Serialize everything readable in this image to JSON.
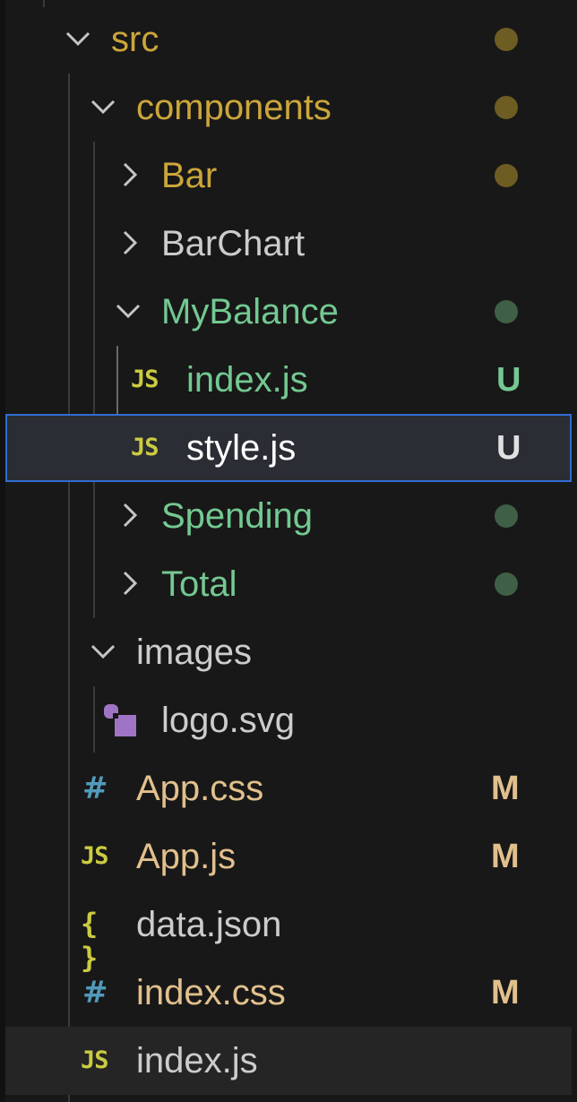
{
  "colors": {
    "background": "#181818",
    "selection_border": "#2f6dd2",
    "folder_modified": "#cca63a",
    "untracked": "#73c991",
    "modified_file": "#e2c08d",
    "js_icon": "#cbcb41",
    "css_icon": "#519aba",
    "svg_icon": "#a074c4"
  },
  "tree": {
    "src": {
      "label": "src",
      "state": "expanded",
      "status": "modified-dot"
    },
    "components": {
      "label": "components",
      "state": "expanded",
      "status": "modified-dot"
    },
    "bar": {
      "label": "Bar",
      "state": "collapsed",
      "status": "modified-dot"
    },
    "barchart": {
      "label": "BarChart",
      "state": "collapsed"
    },
    "mybalance": {
      "label": "MyBalance",
      "state": "expanded",
      "status": "untracked-dot"
    },
    "mybalance_index": {
      "label": "index.js",
      "icon": "js-icon",
      "icon_text": "JS",
      "badge": "U"
    },
    "mybalance_style": {
      "label": "style.js",
      "icon": "js-icon",
      "icon_text": "JS",
      "badge": "U",
      "selected": true
    },
    "spending": {
      "label": "Spending",
      "state": "collapsed",
      "status": "untracked-dot"
    },
    "total": {
      "label": "Total",
      "state": "collapsed",
      "status": "untracked-dot"
    },
    "images": {
      "label": "images",
      "state": "expanded"
    },
    "logo": {
      "label": "logo.svg",
      "icon": "svg-image-icon"
    },
    "app_css": {
      "label": "App.css",
      "icon": "css-hash-icon",
      "icon_text": "#",
      "badge": "M"
    },
    "app_js": {
      "label": "App.js",
      "icon": "js-icon",
      "icon_text": "JS",
      "badge": "M"
    },
    "data_json": {
      "label": "data.json",
      "icon": "json-braces-icon",
      "icon_text": "{ }"
    },
    "index_css": {
      "label": "index.css",
      "icon": "css-hash-icon",
      "icon_text": "#",
      "badge": "M"
    },
    "index_js": {
      "label": "index.js",
      "icon": "js-icon",
      "icon_text": "JS"
    }
  }
}
